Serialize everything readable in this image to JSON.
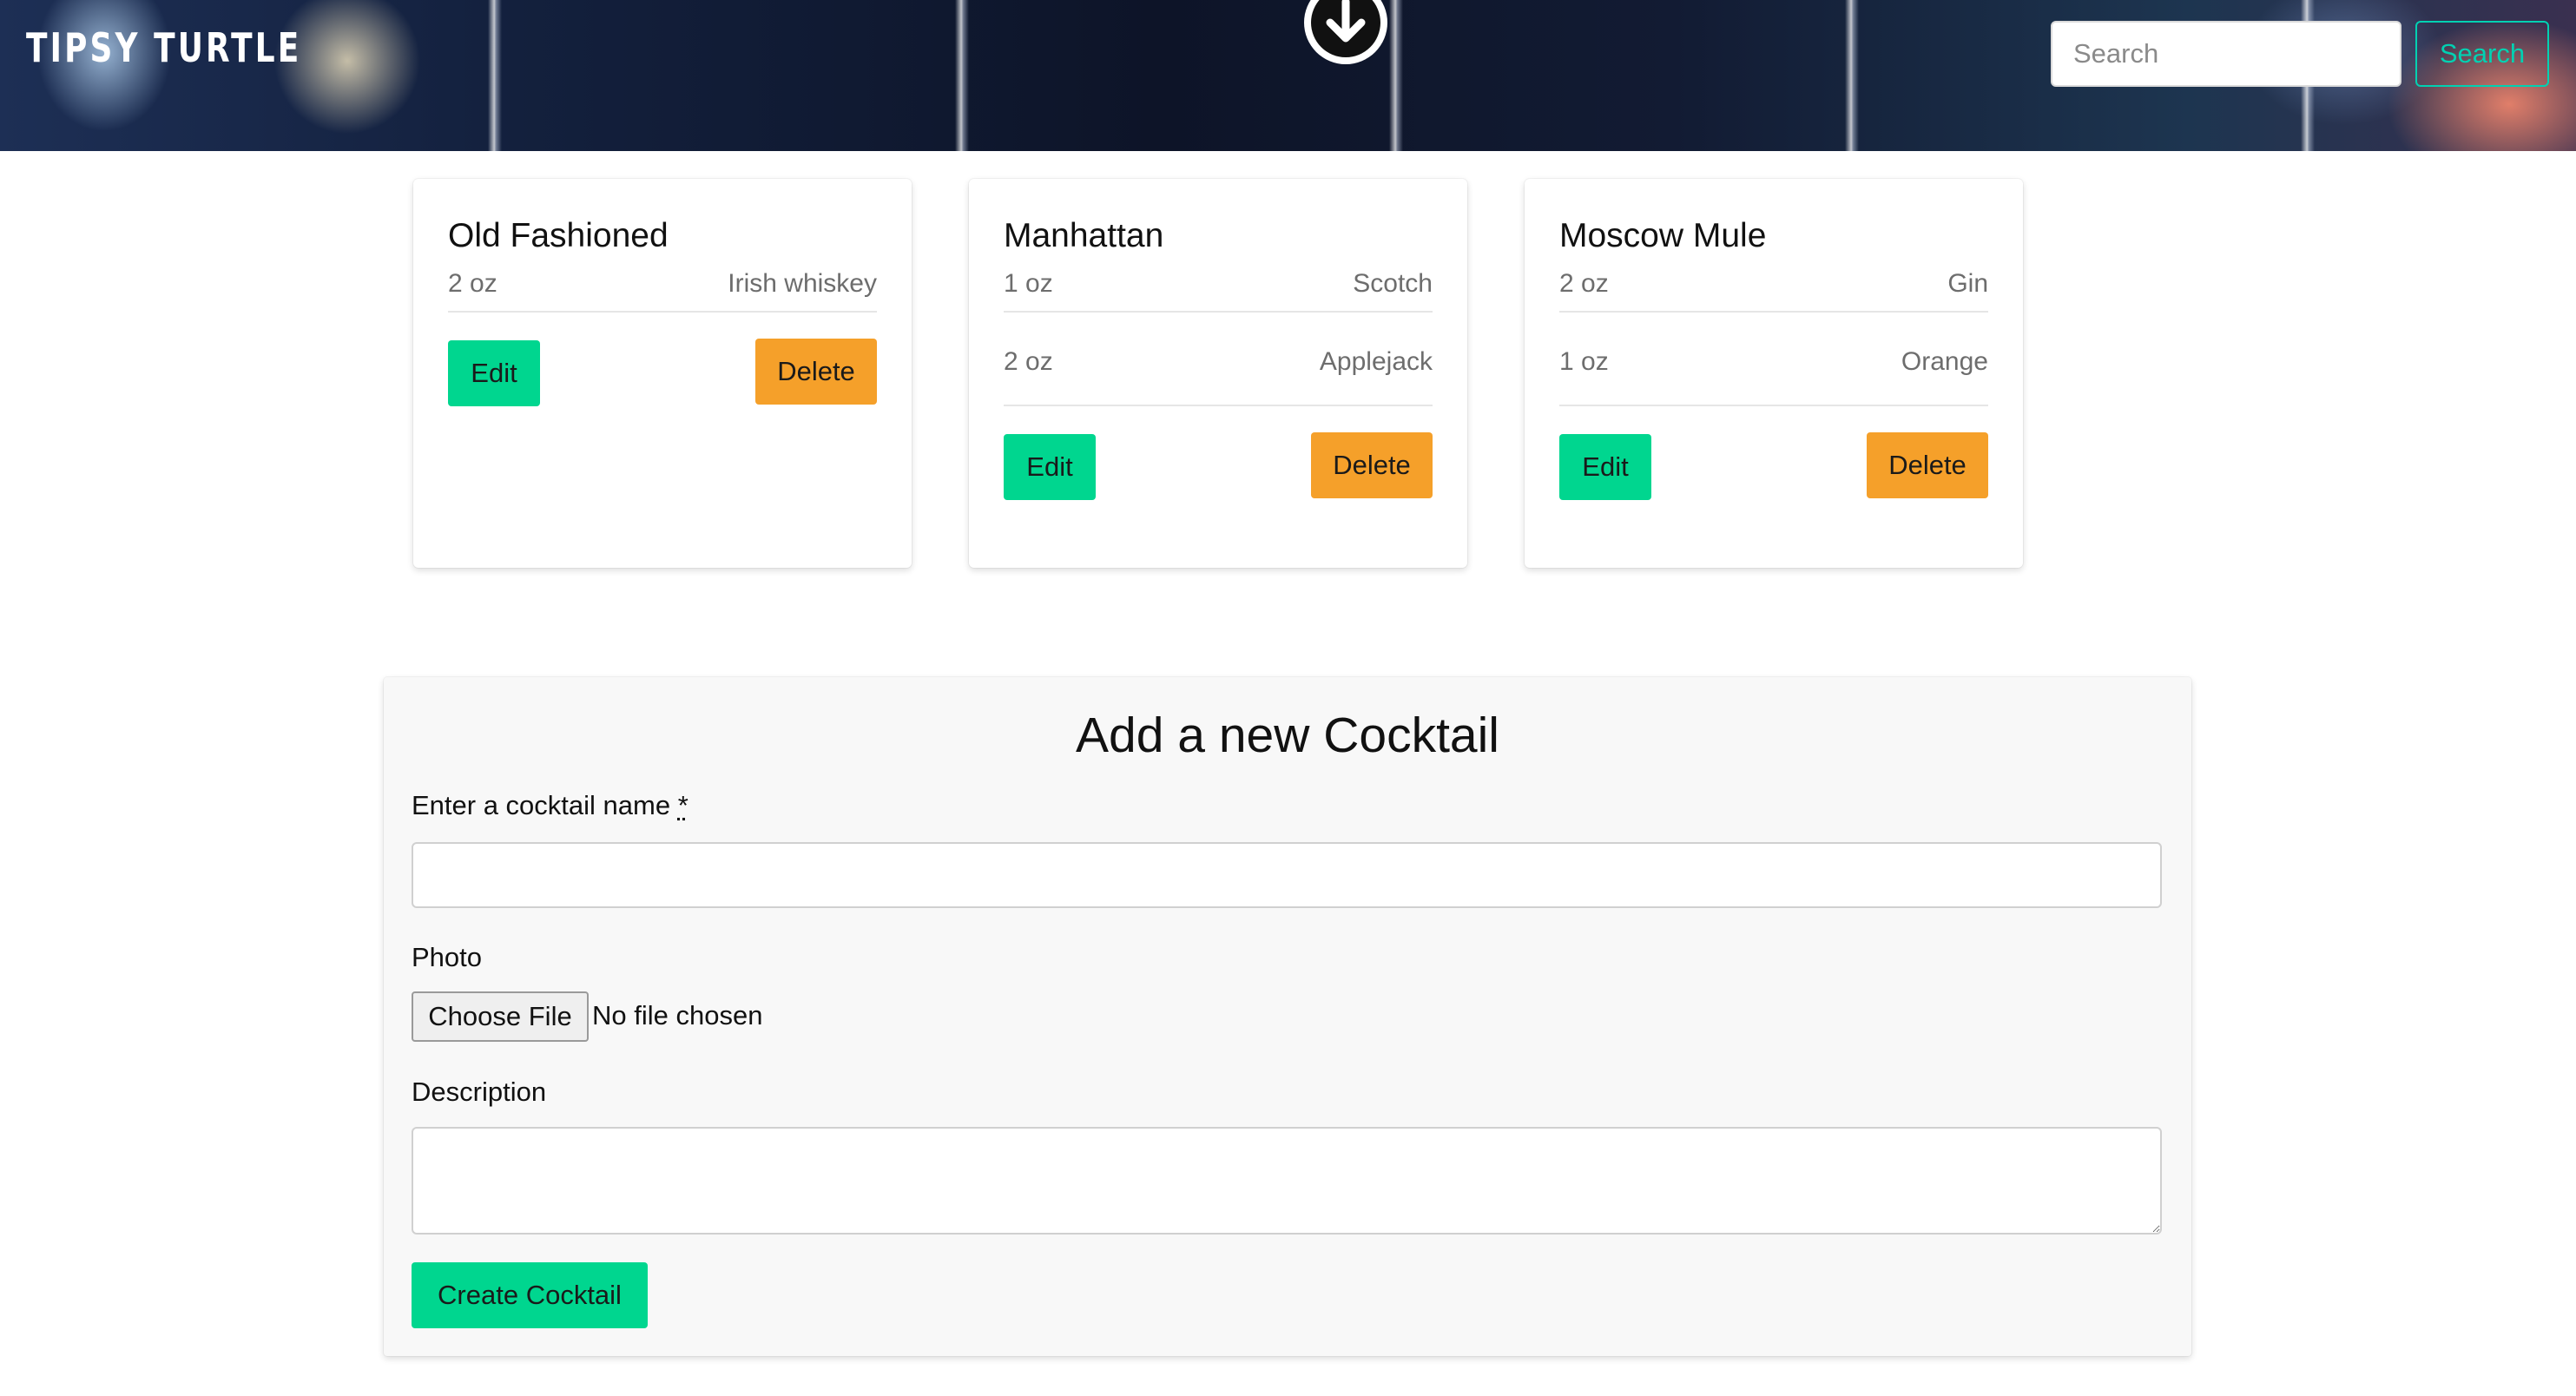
{
  "header": {
    "brand": "TIPSY TURTLE",
    "scroll_icon": "arrow-down-circle-icon",
    "search_placeholder": "Search",
    "search_button": "Search"
  },
  "cocktails": [
    {
      "name": "Old Fashioned",
      "ingredients": [
        {
          "amount": "2 oz",
          "name": "Irish whiskey"
        }
      ],
      "edit_label": "Edit",
      "delete_label": "Delete"
    },
    {
      "name": "Manhattan",
      "ingredients": [
        {
          "amount": "1 oz",
          "name": "Scotch"
        },
        {
          "amount": "2 oz",
          "name": "Applejack"
        }
      ],
      "edit_label": "Edit",
      "delete_label": "Delete"
    },
    {
      "name": "Moscow Mule",
      "ingredients": [
        {
          "amount": "2 oz",
          "name": "Gin"
        },
        {
          "amount": "1 oz",
          "name": "Orange"
        }
      ],
      "edit_label": "Edit",
      "delete_label": "Delete"
    }
  ],
  "form": {
    "title": "Add a new Cocktail",
    "name_label": "Enter a cocktail name",
    "required_marker": "*",
    "name_value": "",
    "photo_label": "Photo",
    "choose_file_label": "Choose File",
    "file_status": "No file chosen",
    "description_label": "Description",
    "description_value": "",
    "create_button": "Create Cocktail"
  },
  "colors": {
    "primary": "#00d1b2",
    "success": "#00d68f",
    "warning": "#f5a02a",
    "form_background": "#f8f8f8"
  }
}
